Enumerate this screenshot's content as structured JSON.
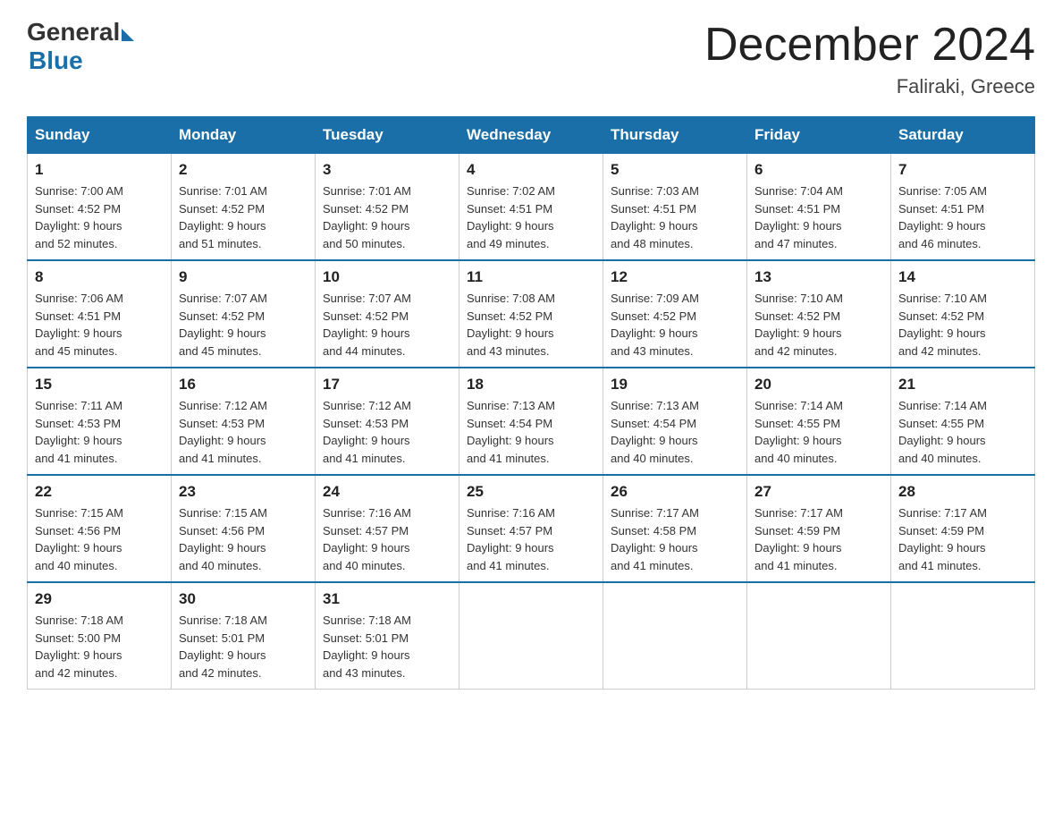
{
  "header": {
    "logo_general": "General",
    "logo_blue": "Blue",
    "month_title": "December 2024",
    "location": "Faliraki, Greece"
  },
  "days_of_week": [
    "Sunday",
    "Monday",
    "Tuesday",
    "Wednesday",
    "Thursday",
    "Friday",
    "Saturday"
  ],
  "weeks": [
    [
      {
        "day": "1",
        "sunrise": "7:00 AM",
        "sunset": "4:52 PM",
        "daylight": "9 hours and 52 minutes."
      },
      {
        "day": "2",
        "sunrise": "7:01 AM",
        "sunset": "4:52 PM",
        "daylight": "9 hours and 51 minutes."
      },
      {
        "day": "3",
        "sunrise": "7:01 AM",
        "sunset": "4:52 PM",
        "daylight": "9 hours and 50 minutes."
      },
      {
        "day": "4",
        "sunrise": "7:02 AM",
        "sunset": "4:51 PM",
        "daylight": "9 hours and 49 minutes."
      },
      {
        "day": "5",
        "sunrise": "7:03 AM",
        "sunset": "4:51 PM",
        "daylight": "9 hours and 48 minutes."
      },
      {
        "day": "6",
        "sunrise": "7:04 AM",
        "sunset": "4:51 PM",
        "daylight": "9 hours and 47 minutes."
      },
      {
        "day": "7",
        "sunrise": "7:05 AM",
        "sunset": "4:51 PM",
        "daylight": "9 hours and 46 minutes."
      }
    ],
    [
      {
        "day": "8",
        "sunrise": "7:06 AM",
        "sunset": "4:51 PM",
        "daylight": "9 hours and 45 minutes."
      },
      {
        "day": "9",
        "sunrise": "7:07 AM",
        "sunset": "4:52 PM",
        "daylight": "9 hours and 45 minutes."
      },
      {
        "day": "10",
        "sunrise": "7:07 AM",
        "sunset": "4:52 PM",
        "daylight": "9 hours and 44 minutes."
      },
      {
        "day": "11",
        "sunrise": "7:08 AM",
        "sunset": "4:52 PM",
        "daylight": "9 hours and 43 minutes."
      },
      {
        "day": "12",
        "sunrise": "7:09 AM",
        "sunset": "4:52 PM",
        "daylight": "9 hours and 43 minutes."
      },
      {
        "day": "13",
        "sunrise": "7:10 AM",
        "sunset": "4:52 PM",
        "daylight": "9 hours and 42 minutes."
      },
      {
        "day": "14",
        "sunrise": "7:10 AM",
        "sunset": "4:52 PM",
        "daylight": "9 hours and 42 minutes."
      }
    ],
    [
      {
        "day": "15",
        "sunrise": "7:11 AM",
        "sunset": "4:53 PM",
        "daylight": "9 hours and 41 minutes."
      },
      {
        "day": "16",
        "sunrise": "7:12 AM",
        "sunset": "4:53 PM",
        "daylight": "9 hours and 41 minutes."
      },
      {
        "day": "17",
        "sunrise": "7:12 AM",
        "sunset": "4:53 PM",
        "daylight": "9 hours and 41 minutes."
      },
      {
        "day": "18",
        "sunrise": "7:13 AM",
        "sunset": "4:54 PM",
        "daylight": "9 hours and 41 minutes."
      },
      {
        "day": "19",
        "sunrise": "7:13 AM",
        "sunset": "4:54 PM",
        "daylight": "9 hours and 40 minutes."
      },
      {
        "day": "20",
        "sunrise": "7:14 AM",
        "sunset": "4:55 PM",
        "daylight": "9 hours and 40 minutes."
      },
      {
        "day": "21",
        "sunrise": "7:14 AM",
        "sunset": "4:55 PM",
        "daylight": "9 hours and 40 minutes."
      }
    ],
    [
      {
        "day": "22",
        "sunrise": "7:15 AM",
        "sunset": "4:56 PM",
        "daylight": "9 hours and 40 minutes."
      },
      {
        "day": "23",
        "sunrise": "7:15 AM",
        "sunset": "4:56 PM",
        "daylight": "9 hours and 40 minutes."
      },
      {
        "day": "24",
        "sunrise": "7:16 AM",
        "sunset": "4:57 PM",
        "daylight": "9 hours and 40 minutes."
      },
      {
        "day": "25",
        "sunrise": "7:16 AM",
        "sunset": "4:57 PM",
        "daylight": "9 hours and 41 minutes."
      },
      {
        "day": "26",
        "sunrise": "7:17 AM",
        "sunset": "4:58 PM",
        "daylight": "9 hours and 41 minutes."
      },
      {
        "day": "27",
        "sunrise": "7:17 AM",
        "sunset": "4:59 PM",
        "daylight": "9 hours and 41 minutes."
      },
      {
        "day": "28",
        "sunrise": "7:17 AM",
        "sunset": "4:59 PM",
        "daylight": "9 hours and 41 minutes."
      }
    ],
    [
      {
        "day": "29",
        "sunrise": "7:18 AM",
        "sunset": "5:00 PM",
        "daylight": "9 hours and 42 minutes."
      },
      {
        "day": "30",
        "sunrise": "7:18 AM",
        "sunset": "5:01 PM",
        "daylight": "9 hours and 42 minutes."
      },
      {
        "day": "31",
        "sunrise": "7:18 AM",
        "sunset": "5:01 PM",
        "daylight": "9 hours and 43 minutes."
      },
      null,
      null,
      null,
      null
    ]
  ],
  "labels": {
    "sunrise": "Sunrise:",
    "sunset": "Sunset:",
    "daylight": "Daylight:"
  }
}
